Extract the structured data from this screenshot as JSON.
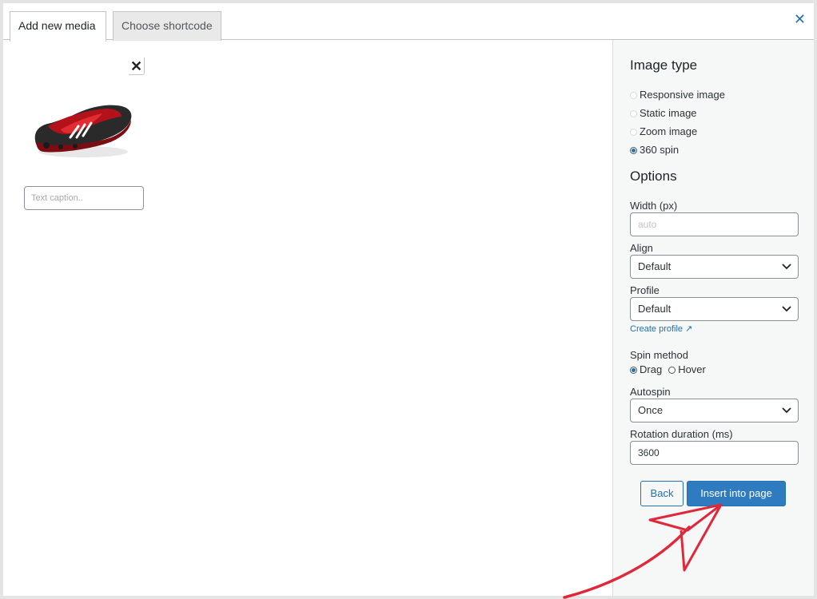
{
  "tabs": [
    {
      "label": "Add new media",
      "active": true
    },
    {
      "label": "Choose shortcode",
      "active": false
    }
  ],
  "media": {
    "caption_placeholder": "Text caption..",
    "image_alt": "red and black sneaker"
  },
  "sidebar": {
    "image_type_heading": "Image type",
    "image_types": [
      {
        "label": "Responsive image",
        "checked": false
      },
      {
        "label": "Static image",
        "checked": false
      },
      {
        "label": "Zoom image",
        "checked": false
      },
      {
        "label": "360 spin",
        "checked": true
      }
    ],
    "options_heading": "Options",
    "width_label": "Width (px)",
    "width_placeholder": "auto",
    "align_label": "Align",
    "align_value": "Default",
    "profile_label": "Profile",
    "profile_value": "Default",
    "create_profile_link": "Create profile ↗",
    "spin_method_label": "Spin method",
    "spin_methods": [
      {
        "label": "Drag",
        "checked": true
      },
      {
        "label": "Hover",
        "checked": false
      }
    ],
    "autospin_label": "Autospin",
    "autospin_value": "Once",
    "rotation_label": "Rotation duration (ms)",
    "rotation_value": "3600"
  },
  "buttons": {
    "back": "Back",
    "insert": "Insert into page"
  },
  "colors": {
    "accent": "#2271b1",
    "annotation_arrow": "#e0283a"
  }
}
